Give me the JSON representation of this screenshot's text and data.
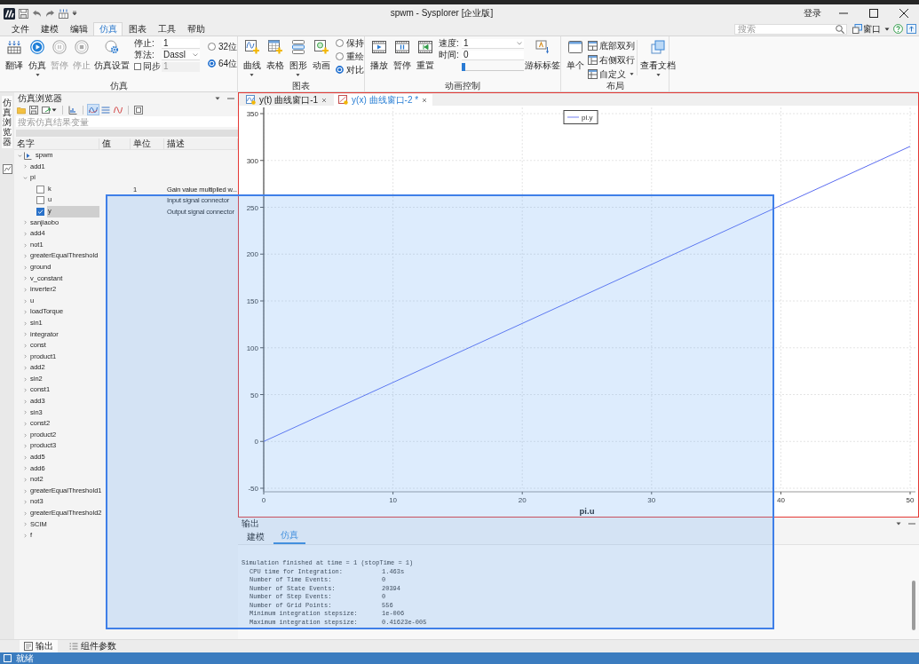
{
  "window": {
    "title": "spwm - Sysplorer [企业版]",
    "login": "登录"
  },
  "menu": [
    {
      "label": "文件",
      "selected": false
    },
    {
      "label": "建模",
      "selected": false
    },
    {
      "label": "编辑",
      "selected": false
    },
    {
      "label": "仿真",
      "selected": true
    },
    {
      "label": "图表",
      "selected": false
    },
    {
      "label": "工具",
      "selected": false
    },
    {
      "label": "帮助",
      "selected": false
    }
  ],
  "search": {
    "placeholder": "搜索"
  },
  "window_menu": {
    "label": "窗口"
  },
  "ribbon": {
    "simulation": {
      "label": "仿真",
      "buttons": [
        {
          "label": "翻译",
          "disabled": false,
          "dropdown": false
        },
        {
          "label": "仿真",
          "disabled": false,
          "dropdown": true
        },
        {
          "label": "暂停",
          "disabled": true,
          "dropdown": false
        },
        {
          "label": "停止",
          "disabled": true,
          "dropdown": false
        },
        {
          "label": "仿真设置",
          "disabled": false,
          "dropdown": false
        }
      ],
      "stop_time": {
        "label": "停止:",
        "value": "1"
      },
      "algorithm": {
        "label": "算法:",
        "value": "Dassl"
      },
      "sync": {
        "label": "同步",
        "checked": false,
        "value": "1",
        "disabled": true
      },
      "precision": [
        {
          "label": "32位",
          "selected": false
        },
        {
          "label": "64位",
          "selected": true
        }
      ]
    },
    "chart": {
      "label": "图表",
      "buttons": [
        {
          "label": "曲线",
          "dropdown": true
        },
        {
          "label": "表格",
          "dropdown": false
        },
        {
          "label": "图形",
          "dropdown": true
        },
        {
          "label": "动画",
          "dropdown": false
        }
      ],
      "modes": [
        {
          "label": "保持",
          "selected": false
        },
        {
          "label": "重绘",
          "selected": false
        },
        {
          "label": "对比",
          "selected": true
        }
      ]
    },
    "animation": {
      "label": "动画控制",
      "buttons": [
        {
          "label": "播放"
        },
        {
          "label": "暂停"
        },
        {
          "label": "重置"
        }
      ],
      "speed": {
        "label": "速度:",
        "value": "1"
      },
      "time": {
        "label": "时间:",
        "value": "0"
      },
      "slider": {
        "level": 0
      },
      "cursor_label": {
        "label": "游标标签"
      }
    },
    "layout": {
      "label": "布局",
      "single": {
        "label": "单个"
      },
      "options": [
        {
          "label": "底部双列",
          "dropdown": false
        },
        {
          "label": "右侧双行",
          "dropdown": false
        },
        {
          "label": "自定义",
          "dropdown": true
        }
      ],
      "docs": {
        "label": "查看文档",
        "dropdown": true
      }
    }
  },
  "browser": {
    "side_tab": "仿真浏览器",
    "title": "仿真浏览器",
    "toolbar": [
      {
        "pressed": false
      },
      {
        "pressed": false
      },
      {
        "pressed": false
      },
      {
        "pressed": false
      },
      {
        "pressed": true
      },
      {
        "pressed": false
      },
      {
        "pressed": false
      },
      {
        "pressed": false
      }
    ],
    "search": {
      "placeholder": "搜索仿真结果变量"
    },
    "columns": [
      "名字",
      "值",
      "单位",
      "描述"
    ],
    "tree": [
      {
        "name": "spwm",
        "kind": "model",
        "expanded": true,
        "selected": false,
        "children": [
          {
            "name": "add1",
            "kind": "component",
            "expanded": false,
            "selected": false
          },
          {
            "name": "pi",
            "kind": "component",
            "expanded": true,
            "selected": false,
            "children": [
              {
                "name": "k",
                "kind": "variable",
                "checked": false,
                "selected": false,
                "unit": "1",
                "description": "Gain value multiplied w..."
              },
              {
                "name": "u",
                "kind": "variable",
                "checked": false,
                "selected": false,
                "description": "Input signal connector"
              },
              {
                "name": "y",
                "kind": "variable",
                "checked": true,
                "selected": true,
                "description": "Output signal connector"
              }
            ]
          },
          {
            "name": "sanjiaobo",
            "kind": "component",
            "expanded": false,
            "selected": false
          },
          {
            "name": "add4",
            "kind": "component",
            "expanded": false,
            "selected": false
          },
          {
            "name": "not1",
            "kind": "component",
            "expanded": false,
            "selected": false
          },
          {
            "name": "greaterEqualThreshold",
            "kind": "component",
            "expanded": false,
            "selected": false
          },
          {
            "name": "ground",
            "kind": "component",
            "expanded": false,
            "selected": false
          },
          {
            "name": "v_constant",
            "kind": "component",
            "expanded": false,
            "selected": false
          },
          {
            "name": "inverter2",
            "kind": "component",
            "expanded": false,
            "selected": false
          },
          {
            "name": "u",
            "kind": "component",
            "expanded": false,
            "selected": false
          },
          {
            "name": "loadTorque",
            "kind": "component",
            "expanded": false,
            "selected": false
          },
          {
            "name": "sin1",
            "kind": "component",
            "expanded": false,
            "selected": false
          },
          {
            "name": "integrator",
            "kind": "component",
            "expanded": false,
            "selected": false
          },
          {
            "name": "const",
            "kind": "component",
            "expanded": false,
            "selected": false
          },
          {
            "name": "product1",
            "kind": "component",
            "expanded": false,
            "selected": false
          },
          {
            "name": "add2",
            "kind": "component",
            "expanded": false,
            "selected": false
          },
          {
            "name": "sin2",
            "kind": "component",
            "expanded": false,
            "selected": false
          },
          {
            "name": "const1",
            "kind": "component",
            "expanded": false,
            "selected": false
          },
          {
            "name": "add3",
            "kind": "component",
            "expanded": false,
            "selected": false
          },
          {
            "name": "sin3",
            "kind": "component",
            "expanded": false,
            "selected": false
          },
          {
            "name": "const2",
            "kind": "component",
            "expanded": false,
            "selected": false
          },
          {
            "name": "product2",
            "kind": "component",
            "expanded": false,
            "selected": false
          },
          {
            "name": "product3",
            "kind": "component",
            "expanded": false,
            "selected": false
          },
          {
            "name": "add5",
            "kind": "component",
            "expanded": false,
            "selected": false
          },
          {
            "name": "add6",
            "kind": "component",
            "expanded": false,
            "selected": false
          },
          {
            "name": "not2",
            "kind": "component",
            "expanded": false,
            "selected": false
          },
          {
            "name": "greaterEqualThreshold1",
            "kind": "component",
            "expanded": false,
            "selected": false
          },
          {
            "name": "not3",
            "kind": "component",
            "expanded": false,
            "selected": false
          },
          {
            "name": "greaterEqualThreshold2",
            "kind": "component",
            "expanded": false,
            "selected": false
          },
          {
            "name": "SCIM",
            "kind": "component",
            "expanded": false,
            "selected": false
          },
          {
            "name": "f",
            "kind": "component",
            "expanded": false,
            "selected": false
          }
        ]
      }
    ]
  },
  "documents": {
    "outlined": true,
    "tabs": [
      {
        "label": "y(t) 曲线窗口-1",
        "selected": false
      },
      {
        "label": "y(x) 曲线窗口-2 *",
        "selected": true
      }
    ],
    "chart_data": {
      "type": "line",
      "xlabel": "pi.u",
      "x": [
        0,
        50
      ],
      "series": [
        {
          "name": "pi.y",
          "color": "#5b6cf0",
          "values": [
            0,
            315
          ]
        }
      ],
      "xlim": [
        0,
        50
      ],
      "ylim": [
        -50,
        350
      ],
      "xticks": [
        0,
        10,
        20,
        30,
        40,
        50
      ],
      "yticks": [
        -50,
        0,
        50,
        100,
        150,
        200,
        250,
        300,
        350
      ],
      "grid": true
    }
  },
  "output": {
    "title": "输出",
    "tabs": [
      {
        "label": "建模",
        "selected": false
      },
      {
        "label": "仿真",
        "selected": true
      }
    ],
    "summary": "Simulation finished at time = 1 (stopTime = 1)",
    "stats": [
      {
        "label": "CPU time for Integration:",
        "value": "1.463s"
      },
      {
        "label": "Number of Time Events:",
        "value": "0"
      },
      {
        "label": "Number of State Events:",
        "value": "20394"
      },
      {
        "label": "Number of Step Events:",
        "value": "0"
      },
      {
        "label": "Number of Grid Points:",
        "value": "556"
      },
      {
        "label": "Minimum integration stepsize:",
        "value": "1e-006"
      },
      {
        "label": "Maximum integration stepsize:",
        "value": "0.41623e-005"
      }
    ]
  },
  "bottom_tabs": [
    {
      "label": "输出",
      "selected": true
    },
    {
      "label": "组件参数",
      "selected": false
    }
  ],
  "status": {
    "text": "就绪"
  },
  "selection_box": true
}
